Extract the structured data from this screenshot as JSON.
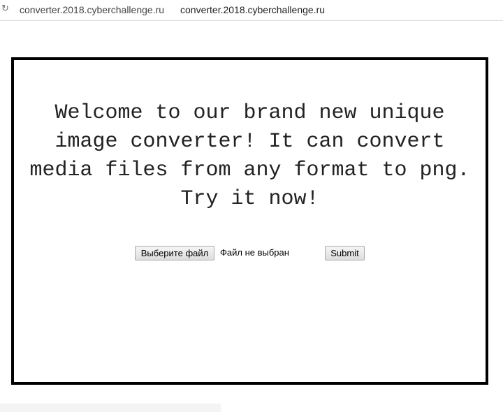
{
  "browser": {
    "url": "converter.2018.cyberchallenge.ru",
    "tab_title": "converter.2018.cyberchallenge.ru",
    "reload_icon": "reload-icon"
  },
  "main": {
    "welcome_text": "Welcome to our brand new unique image converter! It can convert media files from any format to png. Try it now!",
    "upload": {
      "choose_label": "Выберите файл",
      "file_status": "Файл не выбран",
      "submit_label": "Submit"
    }
  },
  "colors": {
    "frame_border": "#000000",
    "text": "#222222",
    "background": "#ffffff"
  }
}
